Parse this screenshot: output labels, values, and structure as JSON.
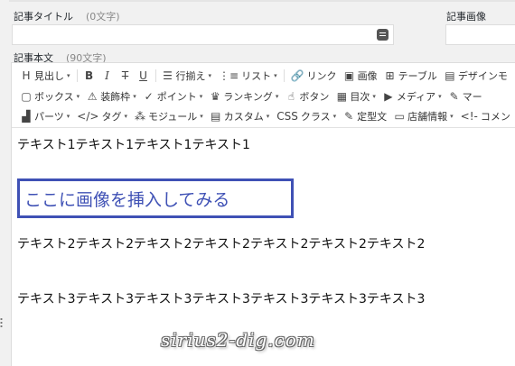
{
  "fields": {
    "title_label": "記事タイトル",
    "title_count": "(0文字)",
    "image_label": "記事画像",
    "body_label": "記事本文",
    "body_count": "(90文字)"
  },
  "toolbar": {
    "row1": [
      {
        "name": "heading-button",
        "icon": "H",
        "label": "見出し",
        "caret": true
      },
      {
        "name": "bold-button",
        "icon": "B",
        "label": "",
        "caret": false
      },
      {
        "name": "italic-button",
        "icon": "I",
        "label": "",
        "caret": false
      },
      {
        "name": "strikethrough-button",
        "icon": "T",
        "label": "",
        "caret": false
      },
      {
        "name": "underline-button",
        "icon": "U",
        "label": "",
        "caret": false
      },
      {
        "name": "align-button",
        "icon": "☰",
        "label": "行揃え",
        "caret": true
      },
      {
        "name": "list-button",
        "icon": "⋮≡",
        "label": "リスト",
        "caret": true
      },
      {
        "name": "link-button",
        "icon": "🔗",
        "label": "リンク",
        "caret": false
      },
      {
        "name": "image-button",
        "icon": "▣",
        "label": "画像",
        "caret": false
      },
      {
        "name": "table-button",
        "icon": "⊞",
        "label": "テーブル",
        "caret": false
      },
      {
        "name": "design-button",
        "icon": "▤",
        "label": "デザインモ",
        "caret": false
      }
    ],
    "row2": [
      {
        "name": "box-button",
        "icon": "▢",
        "label": "ボックス",
        "caret": true
      },
      {
        "name": "decoration-frame-button",
        "icon": "⚠",
        "label": "装飾枠",
        "caret": true
      },
      {
        "name": "point-button",
        "icon": "✓",
        "label": "ポイント",
        "caret": true
      },
      {
        "name": "ranking-button",
        "icon": "♛",
        "label": "ランキング",
        "caret": true
      },
      {
        "name": "button-button",
        "icon": "☝",
        "label": "ボタン",
        "caret": false
      },
      {
        "name": "toc-button",
        "icon": "▦",
        "label": "目次",
        "caret": true
      },
      {
        "name": "media-button",
        "icon": "▶",
        "label": "メディア",
        "caret": true
      },
      {
        "name": "marker-button",
        "icon": "✎",
        "label": "マー",
        "caret": false
      }
    ],
    "row3": [
      {
        "name": "parts-button",
        "icon": "▟",
        "label": "パーツ",
        "caret": true
      },
      {
        "name": "tag-button",
        "icon": "</>",
        "label": "タグ",
        "caret": true
      },
      {
        "name": "module-button",
        "icon": "⁂",
        "label": "モジュール",
        "caret": true
      },
      {
        "name": "custom-button",
        "icon": "▤",
        "label": "カスタム",
        "caret": true
      },
      {
        "name": "class-button",
        "icon": "CSS",
        "label": "クラス",
        "caret": true
      },
      {
        "name": "template-button",
        "icon": "✎",
        "label": "定型文",
        "caret": false
      },
      {
        "name": "shop-info-button",
        "icon": "▭",
        "label": "店舗情報",
        "caret": true
      },
      {
        "name": "comment-button",
        "icon": "<!-",
        "label": "コメン",
        "caret": false
      }
    ]
  },
  "content": {
    "line1": "テキスト1テキスト1テキスト1テキスト1",
    "image_prompt": "ここに画像を挿入してみる",
    "line2": "テキスト2テキスト2テキスト2テキスト2テキスト2テキスト2テキスト2",
    "line3": "テキスト3テキスト3テキスト3テキスト3テキスト3テキスト3テキスト3"
  },
  "watermark": "sirius2-dig.com",
  "colors": {
    "accent": "#3f51b5"
  }
}
